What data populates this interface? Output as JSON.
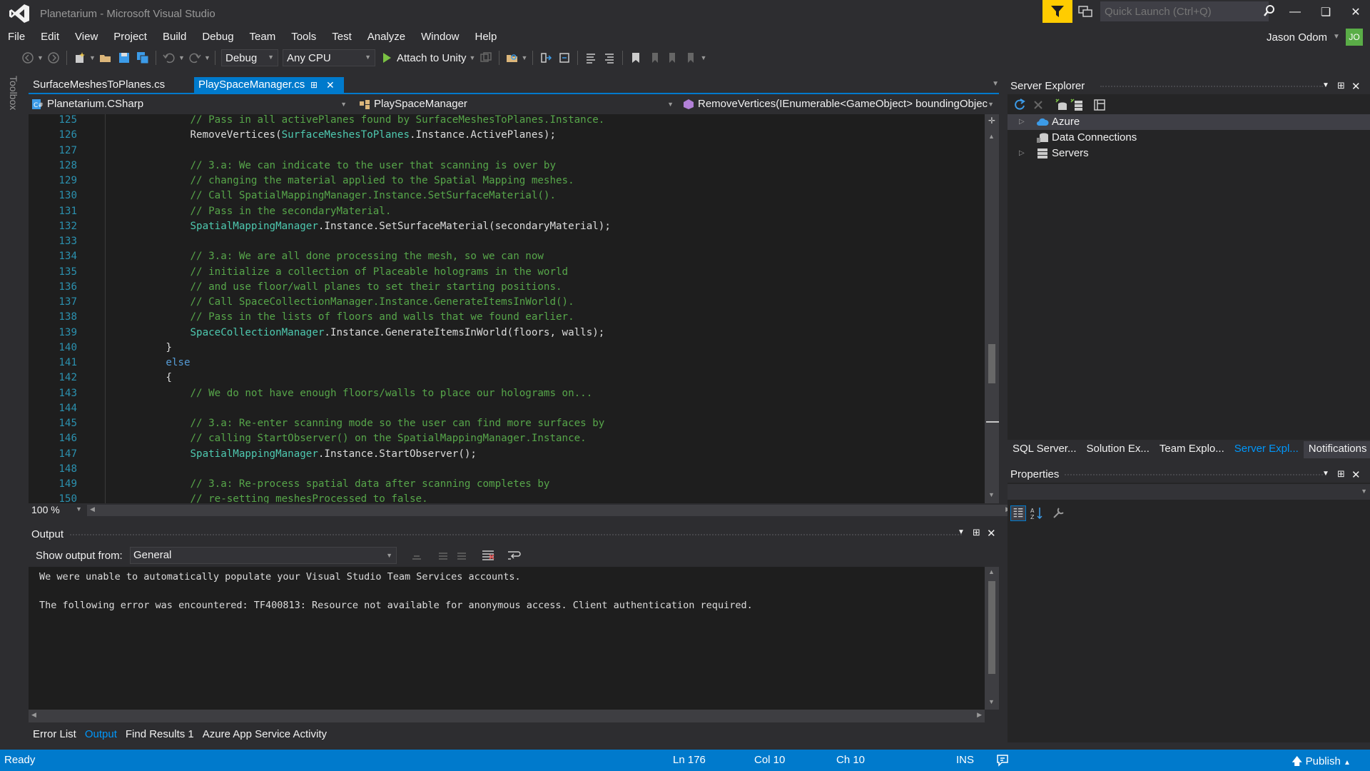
{
  "window": {
    "title": "Planetarium - Microsoft Visual Studio",
    "quick_launch_placeholder": "Quick Launch (Ctrl+Q)",
    "user_name": "Jason Odom",
    "user_initials": "JO"
  },
  "menu": [
    "File",
    "Edit",
    "View",
    "Project",
    "Build",
    "Debug",
    "Team",
    "Tools",
    "Test",
    "Analyze",
    "Window",
    "Help"
  ],
  "toolbar": {
    "config": "Debug",
    "platform": "Any CPU",
    "attach_label": "Attach to Unity"
  },
  "toolbox_label": "Toolbox",
  "editor": {
    "tabs": [
      {
        "label": "SurfaceMeshesToPlanes.cs",
        "active": false
      },
      {
        "label": "PlaySpaceManager.cs",
        "active": true
      }
    ],
    "nav": {
      "project": "Planetarium.CSharp",
      "class": "PlaySpaceManager",
      "member": "RemoveVertices(IEnumerable<GameObject> boundingObject"
    },
    "lines": [
      {
        "n": "125",
        "segs": [
          {
            "t": "            "
          },
          {
            "t": "// Pass in all activePlanes found by SurfaceMeshesToPlanes.Instance.",
            "c": "cmt"
          }
        ]
      },
      {
        "n": "126",
        "segs": [
          {
            "t": "            RemoveVertices("
          },
          {
            "t": "SurfaceMeshesToPlanes",
            "c": "typ"
          },
          {
            "t": ".Instance.ActivePlanes);"
          }
        ]
      },
      {
        "n": "127",
        "segs": [
          {
            "t": ""
          }
        ]
      },
      {
        "n": "128",
        "segs": [
          {
            "t": "            "
          },
          {
            "t": "// 3.a: We can indicate to the user that scanning is over by",
            "c": "cmt"
          }
        ]
      },
      {
        "n": "129",
        "segs": [
          {
            "t": "            "
          },
          {
            "t": "// changing the material applied to the Spatial Mapping meshes.",
            "c": "cmt"
          }
        ]
      },
      {
        "n": "130",
        "segs": [
          {
            "t": "            "
          },
          {
            "t": "// Call SpatialMappingManager.Instance.SetSurfaceMaterial().",
            "c": "cmt"
          }
        ]
      },
      {
        "n": "131",
        "segs": [
          {
            "t": "            "
          },
          {
            "t": "// Pass in the secondaryMaterial.",
            "c": "cmt"
          }
        ]
      },
      {
        "n": "132",
        "segs": [
          {
            "t": "            "
          },
          {
            "t": "SpatialMappingManager",
            "c": "typ"
          },
          {
            "t": ".Instance.SetSurfaceMaterial(secondaryMaterial);"
          }
        ]
      },
      {
        "n": "133",
        "segs": [
          {
            "t": ""
          }
        ]
      },
      {
        "n": "134",
        "segs": [
          {
            "t": "            "
          },
          {
            "t": "// 3.a: We are all done processing the mesh, so we can now",
            "c": "cmt"
          }
        ]
      },
      {
        "n": "135",
        "segs": [
          {
            "t": "            "
          },
          {
            "t": "// initialize a collection of Placeable holograms in the world",
            "c": "cmt"
          }
        ]
      },
      {
        "n": "136",
        "segs": [
          {
            "t": "            "
          },
          {
            "t": "// and use floor/wall planes to set their starting positions.",
            "c": "cmt"
          }
        ]
      },
      {
        "n": "137",
        "segs": [
          {
            "t": "            "
          },
          {
            "t": "// Call SpaceCollectionManager.Instance.GenerateItemsInWorld().",
            "c": "cmt"
          }
        ]
      },
      {
        "n": "138",
        "segs": [
          {
            "t": "            "
          },
          {
            "t": "// Pass in the lists of floors and walls that we found earlier.",
            "c": "cmt"
          }
        ]
      },
      {
        "n": "139",
        "segs": [
          {
            "t": "            "
          },
          {
            "t": "SpaceCollectionManager",
            "c": "typ"
          },
          {
            "t": ".Instance.GenerateItemsInWorld(floors, walls);"
          }
        ]
      },
      {
        "n": "140",
        "segs": [
          {
            "t": "        }"
          }
        ]
      },
      {
        "n": "141",
        "segs": [
          {
            "t": "        "
          },
          {
            "t": "else",
            "c": "kw"
          }
        ]
      },
      {
        "n": "142",
        "segs": [
          {
            "t": "        {"
          }
        ]
      },
      {
        "n": "143",
        "segs": [
          {
            "t": "            "
          },
          {
            "t": "// We do not have enough floors/walls to place our holograms on...",
            "c": "cmt"
          }
        ]
      },
      {
        "n": "144",
        "segs": [
          {
            "t": ""
          }
        ]
      },
      {
        "n": "145",
        "segs": [
          {
            "t": "            "
          },
          {
            "t": "// 3.a: Re-enter scanning mode so the user can find more surfaces by",
            "c": "cmt"
          }
        ]
      },
      {
        "n": "146",
        "segs": [
          {
            "t": "            "
          },
          {
            "t": "// calling StartObserver() on the SpatialMappingManager.Instance.",
            "c": "cmt"
          }
        ]
      },
      {
        "n": "147",
        "segs": [
          {
            "t": "            "
          },
          {
            "t": "SpatialMappingManager",
            "c": "typ"
          },
          {
            "t": ".Instance.StartObserver();"
          }
        ]
      },
      {
        "n": "148",
        "segs": [
          {
            "t": ""
          }
        ]
      },
      {
        "n": "149",
        "segs": [
          {
            "t": "            "
          },
          {
            "t": "// 3.a: Re-process spatial data after scanning completes by",
            "c": "cmt"
          }
        ]
      },
      {
        "n": "150",
        "segs": [
          {
            "t": "            "
          },
          {
            "t": "// re-setting meshesProcessed to false.",
            "c": "cmt"
          }
        ]
      }
    ],
    "zoom": "100 %"
  },
  "output": {
    "title": "Output",
    "show_from_label": "Show output from:",
    "source": "General",
    "text": "We were unable to automatically populate your Visual Studio Team Services accounts.\n\nThe following error was encountered: TF400813: Resource not available for anonymous access. Client authentication required."
  },
  "bottom_tabs": [
    {
      "label": "Error List",
      "active": false
    },
    {
      "label": "Output",
      "active": true
    },
    {
      "label": "Find Results 1",
      "active": false
    },
    {
      "label": "Azure App Service Activity",
      "active": false
    }
  ],
  "server_explorer": {
    "title": "Server Explorer",
    "tree": [
      {
        "label": "Azure",
        "expandable": true,
        "selected": true,
        "icon": "azure-cloud-icon"
      },
      {
        "label": "Data Connections",
        "expandable": false,
        "selected": false,
        "icon": "data-connections-icon"
      },
      {
        "label": "Servers",
        "expandable": true,
        "selected": false,
        "icon": "servers-icon"
      }
    ]
  },
  "panel_tabs": [
    {
      "label": "SQL Server...",
      "active": false
    },
    {
      "label": "Solution Ex...",
      "active": false
    },
    {
      "label": "Team Explo...",
      "active": false
    },
    {
      "label": "Server Expl...",
      "active": true
    },
    {
      "label": "Notifications",
      "active": false
    }
  ],
  "properties": {
    "title": "Properties"
  },
  "status": {
    "state": "Ready",
    "line": "Ln 176",
    "col": "Col 10",
    "ch": "Ch 10",
    "mode": "INS",
    "publish": "Publish"
  },
  "colors": {
    "accent": "#007acc",
    "comment": "#57a64a",
    "type": "#4ec9b0",
    "keyword": "#569cd6",
    "line_number": "#2b91af"
  }
}
